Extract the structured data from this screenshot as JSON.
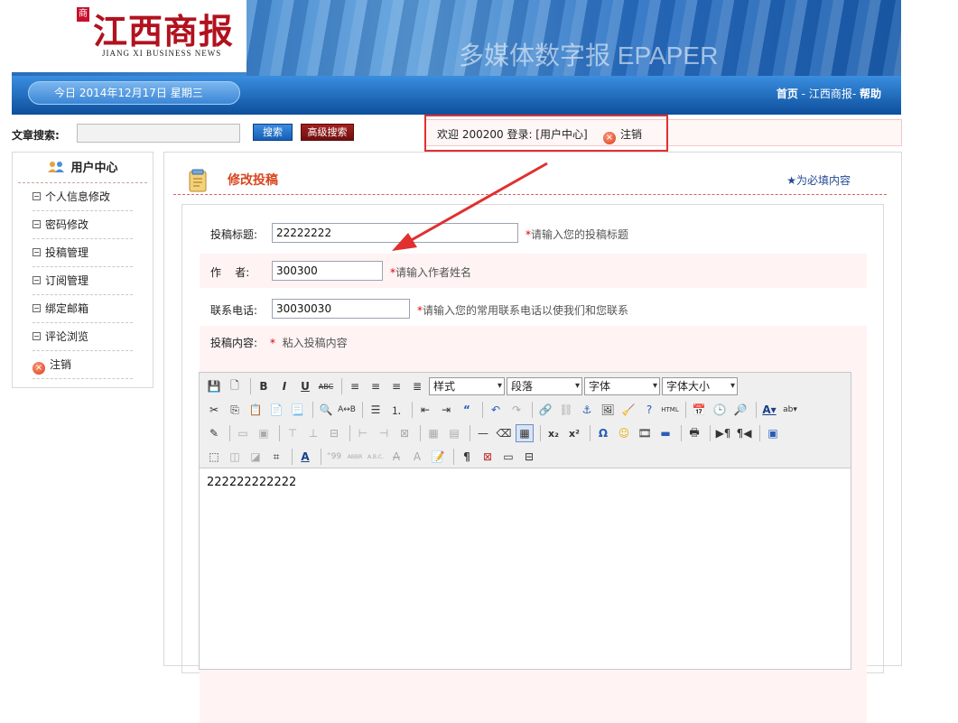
{
  "banner": {
    "logo_mark": "商",
    "logo_title": "江西商报",
    "logo_subtitle": "JIANG XI BUSINESS NEWS",
    "epaper_text": "多媒体数字报 EPAPER",
    "date_text": "今日   2014年12月17日  星期三",
    "nav_home": "首页",
    "nav_sep1": " - ",
    "nav_site": "江西商报",
    "nav_sep2": "- ",
    "nav_help": "帮助"
  },
  "search": {
    "label": "文章搜索:",
    "input_value": "",
    "search_button": "搜索",
    "advanced_button": "高级搜索"
  },
  "welcome": {
    "text": "欢迎  200200  登录: [用户中心]",
    "logout_label": "注销"
  },
  "sidebar": {
    "title": "用户中心",
    "items": [
      {
        "label": "个人信息修改"
      },
      {
        "label": "密码修改"
      },
      {
        "label": "投稿管理"
      },
      {
        "label": "订阅管理"
      },
      {
        "label": "绑定邮箱"
      },
      {
        "label": "评论浏览"
      },
      {
        "label": "注销"
      }
    ]
  },
  "main": {
    "title": "修改投稿",
    "required_note": "★为必填内容"
  },
  "form": {
    "title_label": "投稿标题:",
    "title_value": "22222222",
    "title_hint": "请输入您的投稿标题",
    "author_label": "作    者:",
    "author_value": "300300",
    "author_hint": "请输入作者姓名",
    "phone_label": "联系电话:",
    "phone_value": "30030030",
    "phone_hint": "请输入您的常用联系电话以使我们和您联系",
    "content_label": "投稿内容:",
    "content_star": "*",
    "content_hint": "粘入投稿内容",
    "star": "*"
  },
  "editor": {
    "style_select": "样式",
    "paragraph_select": "段落",
    "font_select": "字体",
    "fontsize_select": "字体大小",
    "body_text": "222222222222"
  }
}
